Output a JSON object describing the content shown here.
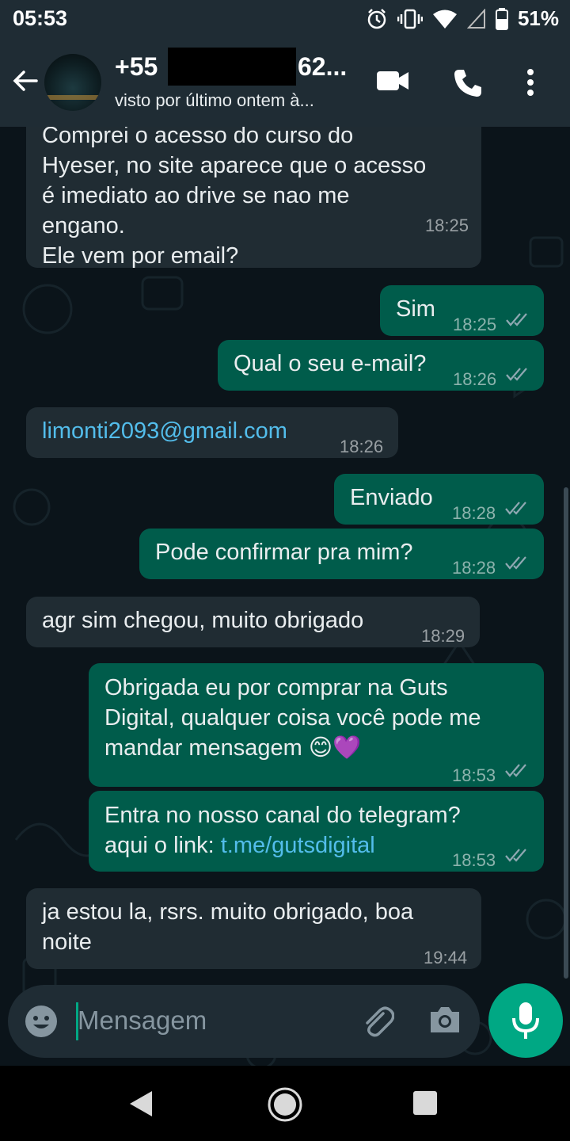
{
  "status_bar": {
    "time": "05:53",
    "battery": "51%",
    "icons": [
      "alarm-icon",
      "vibrate-icon",
      "wifi-icon",
      "signal-icon",
      "battery-icon"
    ]
  },
  "header": {
    "name_prefix": "+55",
    "name_suffix": "62...",
    "status": "visto por último ontem à..."
  },
  "messages": [
    {
      "dir": "in",
      "text": "Comprei o acesso do curso do\nHyeser, no site aparece que o acesso\né imediato ao drive se nao me\nengano.\nEle vem por email?",
      "time": "18:25"
    },
    {
      "dir": "out",
      "text": "Sim",
      "time": "18:25",
      "read": true
    },
    {
      "dir": "out",
      "text": "Qual o seu e-mail?",
      "time": "18:26",
      "read": true
    },
    {
      "dir": "in",
      "text": "limonti2093@gmail.com",
      "time": "18:26",
      "link": true
    },
    {
      "dir": "out",
      "text": "Enviado",
      "time": "18:28",
      "read": true
    },
    {
      "dir": "out",
      "text": "Pode confirmar pra mim?",
      "time": "18:28",
      "read": true
    },
    {
      "dir": "in",
      "text": "agr sim chegou, muito obrigado",
      "time": "18:29"
    },
    {
      "dir": "out",
      "text": "Obrigada eu por comprar na Guts\nDigital, qualquer coisa você pode me\nmandar mensagem 😊💜",
      "time": "18:53",
      "read": true
    },
    {
      "dir": "out",
      "text_prefix": "Entra no nosso canal do telegram?\naqui o link: ",
      "link_text": "t.me/gutsdigital",
      "time": "18:53",
      "read": true
    },
    {
      "dir": "in",
      "text": "ja estou la, rsrs. muito obrigado, boa\nnoite",
      "time": "19:44"
    }
  ],
  "input": {
    "placeholder": "Mensagem"
  },
  "colors": {
    "incoming_bubble": "#202c33",
    "outgoing_bubble": "#005c4b",
    "accent": "#00a884",
    "link": "#53bdeb",
    "background": "#0b141a"
  }
}
